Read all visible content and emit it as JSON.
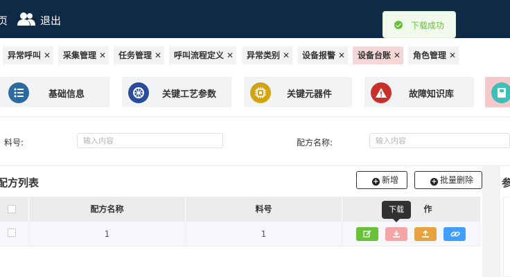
{
  "header": {
    "home_label": "页",
    "logout_label": "退出"
  },
  "toast": {
    "message": "下载成功"
  },
  "tabs": [
    {
      "label": "异常呼叫",
      "active": false
    },
    {
      "label": "采集管理",
      "active": false
    },
    {
      "label": "任务管理",
      "active": false
    },
    {
      "label": "呼叫流程定义",
      "active": false
    },
    {
      "label": "异常类别",
      "active": false
    },
    {
      "label": "设备报警",
      "active": false
    },
    {
      "label": "设备台账",
      "active": true
    },
    {
      "label": "角色管理",
      "active": false
    }
  ],
  "tab_close_glyph": "✕",
  "cards": [
    {
      "label": "基础信息",
      "icon": "list-icon",
      "color": "#2d6a9f"
    },
    {
      "label": "关键工艺参数",
      "icon": "settings-icon",
      "color": "#2a4d9b"
    },
    {
      "label": "关键元器件",
      "icon": "chip-icon",
      "color": "#d1a415"
    },
    {
      "label": "故障知识库",
      "icon": "warning-icon",
      "color": "#c9302c"
    },
    {
      "label": "",
      "icon": "save-icon",
      "color": "#3cc0b8"
    }
  ],
  "search": {
    "material_label": "料号:",
    "material_placeholder": "输入内容",
    "recipe_label": "配方名称:",
    "recipe_placeholder": "输入内容"
  },
  "table": {
    "title": "配方列表",
    "add_label": "新增",
    "batch_delete_label": "批量删除",
    "columns": [
      "配方名称",
      "料号",
      "作"
    ],
    "rows": [
      {
        "name": "1",
        "material": "1"
      }
    ],
    "tooltip": "下载"
  },
  "right_panel": {
    "title": "参"
  },
  "colors": {
    "header_bg": "#0e2a47",
    "edit": "#67c23a",
    "download": "#f5a5a5",
    "upload": "#e6a23c",
    "link": "#409eff"
  }
}
